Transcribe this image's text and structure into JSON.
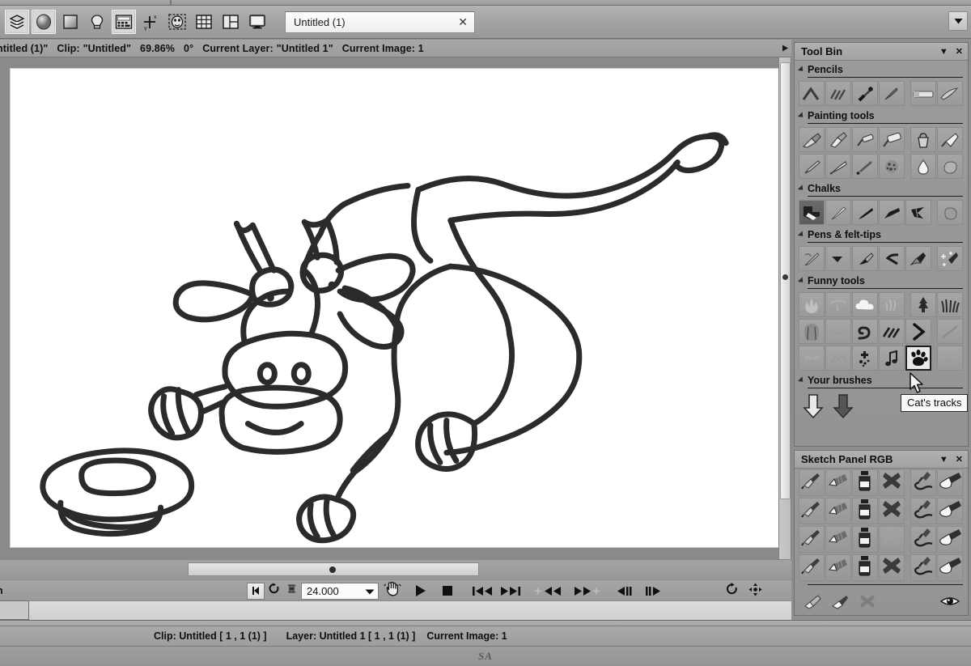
{
  "app": {
    "title_tab": "Untitled (1)",
    "tab_close": "✕"
  },
  "toolbar": {
    "buttons": [
      {
        "name": "layers-icon",
        "label": "Layers"
      },
      {
        "name": "sphere-icon",
        "label": "Render"
      },
      {
        "name": "square-gradient-icon",
        "label": "Gradient"
      },
      {
        "name": "lightbulb-icon",
        "label": "Light"
      },
      {
        "name": "calculator-icon",
        "label": "Calculator"
      },
      {
        "name": "axis-xy-icon",
        "label": "Axis"
      },
      {
        "name": "face-mask-icon",
        "label": "Mask"
      },
      {
        "name": "grid-icon",
        "label": "Grid"
      },
      {
        "name": "layout-icon",
        "label": "Layout"
      },
      {
        "name": "monitor-icon",
        "label": "Monitor"
      }
    ],
    "overflow_arrow": "▼"
  },
  "infobar": {
    "doc": "ntitled (1)\"",
    "clip_label": "Clip:",
    "clip_value": "\"Untitled\"",
    "zoom": "69.86%",
    "angle": "0°",
    "layer_label": "Current Layer:",
    "layer_value": "\"Untitled 1\"",
    "image_label": "Current Image: 1"
  },
  "transport": {
    "left_label": "n",
    "fps_value": "24.000",
    "fps_dropdown": "▼",
    "buttons": [
      {
        "name": "prev-frame-edge-button",
        "glyph": "◀"
      },
      {
        "name": "loop-button",
        "glyph": "loop"
      },
      {
        "name": "pingpong-button",
        "glyph": "pingpong"
      },
      {
        "name": "hand-button",
        "glyph": "hand"
      },
      {
        "name": "play-button",
        "glyph": "▶"
      },
      {
        "name": "stop-button",
        "glyph": "■"
      },
      {
        "name": "go-to-start-button",
        "glyph": "|◀◀"
      },
      {
        "name": "go-to-end-button",
        "glyph": "▶▶|"
      },
      {
        "name": "step-back-mark-button",
        "glyph": "+◀◀"
      },
      {
        "name": "step-fwd-mark-button",
        "glyph": "▶▶+"
      },
      {
        "name": "step-back-frame-button",
        "glyph": "◀||"
      },
      {
        "name": "step-fwd-frame-button",
        "glyph": "||▶"
      }
    ],
    "rotate_icon": "rotate-icon",
    "pan_icon": "pan-icon"
  },
  "tool_bin": {
    "title": "Tool Bin",
    "collapse": "▼",
    "close": "✕",
    "groups": [
      {
        "name": "Pencils",
        "rows": [
          [
            "pencil-stroke-icon",
            "pencil-sketch-icon",
            "pencil-dark-tip-icon",
            "pencil-thin-icon",
            "__gap__",
            "eraser-block-icon",
            "pencil-flat-icon"
          ]
        ]
      },
      {
        "name": "Painting tools",
        "rows": [
          [
            "brush-round-icon",
            "brush-flat-icon",
            "roller-small-icon",
            "roller-large-icon",
            "__gap__",
            "paint-bucket-icon",
            "trowel-icon"
          ],
          [
            "knife-icon",
            "palette-knife-icon",
            "fine-brush-icon",
            "sponge-icon",
            "__gap__",
            "water-drop-icon",
            "smudge-icon"
          ]
        ]
      },
      {
        "name": "Chalks",
        "rows": [
          [
            "chalk-bold-icon",
            "chalk-thin-icon",
            "chalk-black-icon",
            "chalk-wedge-icon",
            "chalk-angled-icon",
            "__gap__",
            "chalk-smudge-icon"
          ]
        ]
      },
      {
        "name": "Pens & felt-tips",
        "rows": [
          [
            "pen-nib-icon",
            "felt-tip-icon",
            "marker-icon",
            "calligraphy-pen-icon",
            "fountain-pen-icon",
            "__gap__",
            "sparkle-pen-icon"
          ]
        ]
      },
      {
        "name": "Funny tools",
        "rows": [
          [
            "fire-icon",
            "wire-icon",
            "cloud-icon",
            "splash-icon",
            "__gap__",
            "tree-icon",
            "grass-icon"
          ],
          [
            "hair-icon",
            "fur-icon",
            "snake-icon",
            "hatch-icon",
            "chevron-icon",
            "__gap__",
            "line-icon"
          ],
          [
            "butterfly-icon",
            "mountain-icon",
            "puzzle-icon",
            "music-note-icon",
            "cat-tracks-icon",
            "__gap__",
            "scribble-icon"
          ]
        ]
      },
      {
        "name": "Your brushes",
        "rows": [
          [
            "arrow-down-outline-icon",
            "arrow-down-solid-icon"
          ]
        ]
      }
    ],
    "tooltip": "Cat's tracks",
    "selected_tool": "cat-tracks-icon"
  },
  "sketch_panel": {
    "title": "Sketch Panel RGB",
    "collapse": "▼",
    "close": "✕",
    "rows": [
      [
        "airbrush-icon",
        "pencil-shaded-icon",
        "ink-bottle-icon",
        "x-mark-icon",
        "__gap__",
        "squiggle-pen-icon",
        "brush-tip-icon"
      ],
      [
        "airbrush-icon",
        "pencil-shaded-icon",
        "ink-bottle-icon",
        "x-mark-icon",
        "__gap__",
        "squiggle-pen-icon",
        "brush-tip-icon"
      ],
      [
        "airbrush-icon",
        "pencil-shaded-icon",
        "ink-bottle-icon",
        "x-mark-faded-icon",
        "__gap__",
        "squiggle-pen-icon",
        "brush-tip-icon"
      ],
      [
        "airbrush-icon",
        "pencil-shaded-icon",
        "ink-bottle-icon",
        "x-mark-icon",
        "__gap__",
        "squiggle-pen-icon",
        "brush-tip-icon"
      ]
    ],
    "footer_icons": [
      "eraser-tool-icon",
      "brush-white-icon",
      "x-mark-icon"
    ],
    "visibility_icon": "eye-icon"
  },
  "statusbar": {
    "clip": "Clip: Untitled [ 1 , 1  (1) ]",
    "layer": "Layer: Untitled 1 [ 1 , 1  (1) ]",
    "image": "Current Image: 1"
  },
  "footer": {
    "watermark": "SA"
  },
  "canvas": {
    "artwork": "hand-drawn cow lying down with feed bowl",
    "stroke_color": "#2b2b2b",
    "background": "#ffffff"
  },
  "colors": {
    "chrome": "#9d9d9d",
    "panel": "#949494",
    "toolbar": "#a4a4a4",
    "text": "#0e0e0e",
    "canvas_bg": "#ffffff",
    "ink": "#2b2b2b"
  }
}
